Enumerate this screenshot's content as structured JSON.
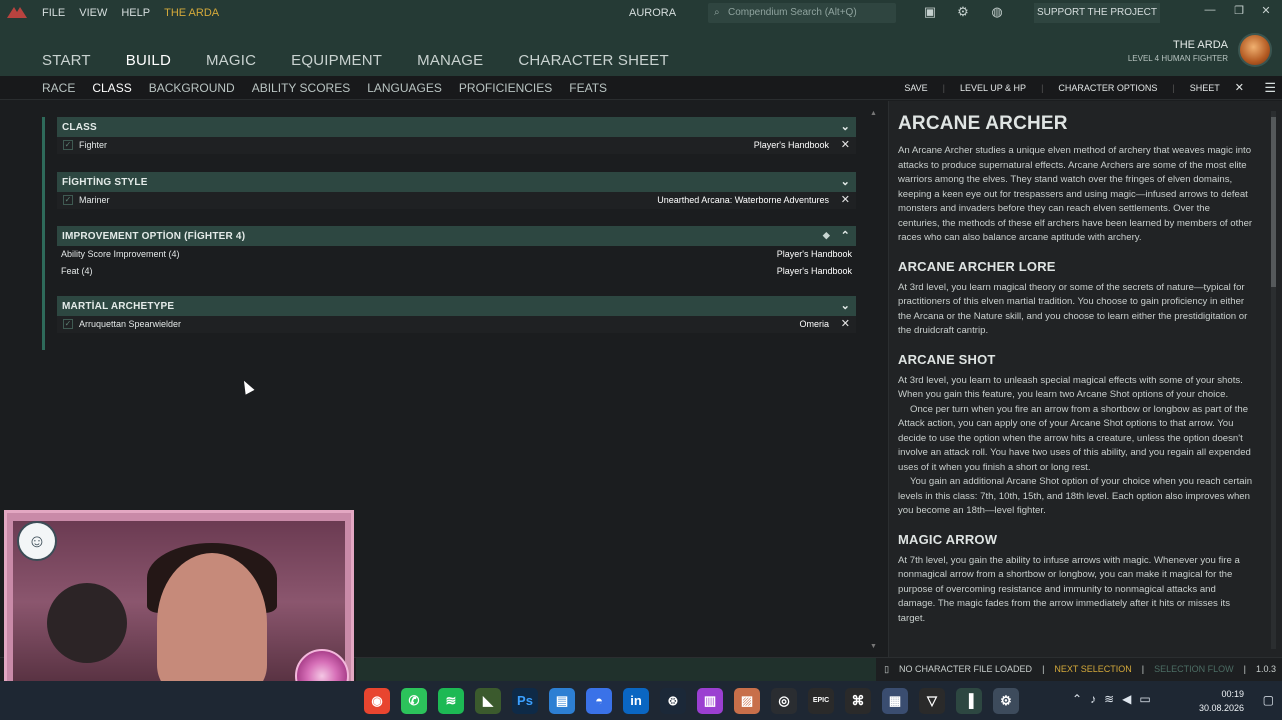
{
  "titlebar": {
    "menus": [
      "FILE",
      "VIEW",
      "HELP"
    ],
    "brand": "THE ARDA",
    "app_name": "AURORA",
    "search_placeholder": "Compendium Search (Alt+Q)",
    "support_label": "SUPPORT THE PROJECT"
  },
  "main_nav": [
    "START",
    "BUILD",
    "MAGIC",
    "EQUIPMENT",
    "MANAGE",
    "CHARACTER SHEET"
  ],
  "main_nav_active": "BUILD",
  "character": {
    "name": "THE ARDA",
    "subtitle": "LEVEL 4 HUMAN FIGHTER"
  },
  "sub_nav": {
    "tabs": [
      "RACE",
      "CLASS",
      "BACKGROUND",
      "ABILITY SCORES",
      "LANGUAGES",
      "PROFICIENCIES",
      "FEATS"
    ],
    "active": "CLASS",
    "actions": [
      "SAVE",
      "LEVEL UP & HP",
      "CHARACTER OPTIONS",
      "SHEET"
    ]
  },
  "sections": {
    "class": {
      "title": "CLASS",
      "item": "Fighter",
      "source": "Player's Handbook"
    },
    "fighting_style": {
      "title": "FİGHTİNG STYLE",
      "item": "Mariner",
      "source": "Unearthed Arcana: Waterborne Adventures"
    },
    "improvement": {
      "title": "IMPROVEMENT OPTİON (FİGHTER 4)",
      "options": [
        {
          "name": "Ability Score Improvement (4)",
          "source": "Player's Handbook"
        },
        {
          "name": "Feat (4)",
          "source": "Player's Handbook"
        }
      ]
    },
    "archetype": {
      "title": "MARTİAL ARCHETYPE",
      "item": "Arruquettan Spearwielder",
      "source": "Omeria"
    }
  },
  "detail": {
    "title": "ARCANE ARCHER",
    "intro": "An Arcane Archer studies a unique elven method of archery that weaves magic into attacks to produce supernatural effects. Arcane Archers are some of the most elite warriors among the elves. They stand watch over the fringes of elven domains, keeping a keen eye out for trespassers and using magic—infused arrows to defeat monsters and invaders before they can reach elven settlements. Over the centuries, the methods of these elf archers have been learned by members of other races who can also balance arcane aptitude with archery.",
    "lore_title": "ARCANE ARCHER LORE",
    "lore_text": "At 3rd level, you learn magical theory or some of the secrets of nature—typical for practitioners of this elven martial tradition. You choose to gain proficiency in either the Arcana or the Nature skill, and you choose to learn either the prestidigitation or the druidcraft cantrip.",
    "shot_title": "ARCANE SHOT",
    "shot_p1": "At 3rd level, you learn to unleash special magical effects with some of your shots. When you gain this feature, you learn two Arcane Shot options of your choice.",
    "shot_p2": "Once per turn when you fire an arrow from a shortbow or longbow as part of the Attack action, you can apply one of your Arcane Shot options to that arrow. You decide to use the option when the arrow hits a creature, unless the option doesn't involve an attack roll. You have two uses of this ability, and you regain all expended uses of it when you finish a short or long rest.",
    "shot_p3": "You gain an additional Arcane Shot option of your choice when you reach certain levels in this class: 7th, 10th, 15th, and 18th level. Each option also improves when you become an 18th—level fighter.",
    "arrow_title": "MAGIC ARROW",
    "arrow_text": "At 7th level, you gain the ability to infuse arrows with magic. Whenever you fire a nonmagical arrow from a shortbow or longbow, you can make it magical for the purpose of overcoming resistance and immunity to nonmagical attacks and damage. The magic fades from the arrow immediately after it hits or misses its target."
  },
  "status_bar": {
    "file_status": "NO CHARACTER FILE LOADED",
    "next_selection": "NEXT SELECTION",
    "selection_flow": "SELECTION FLOW",
    "version": "1.0.3"
  },
  "taskbar": {
    "time": "00:19",
    "date": "30.08.2026"
  },
  "colors": {
    "header_bg": "#253a35",
    "section_head": "#2d4741",
    "brand_gold": "#d4a93a"
  }
}
